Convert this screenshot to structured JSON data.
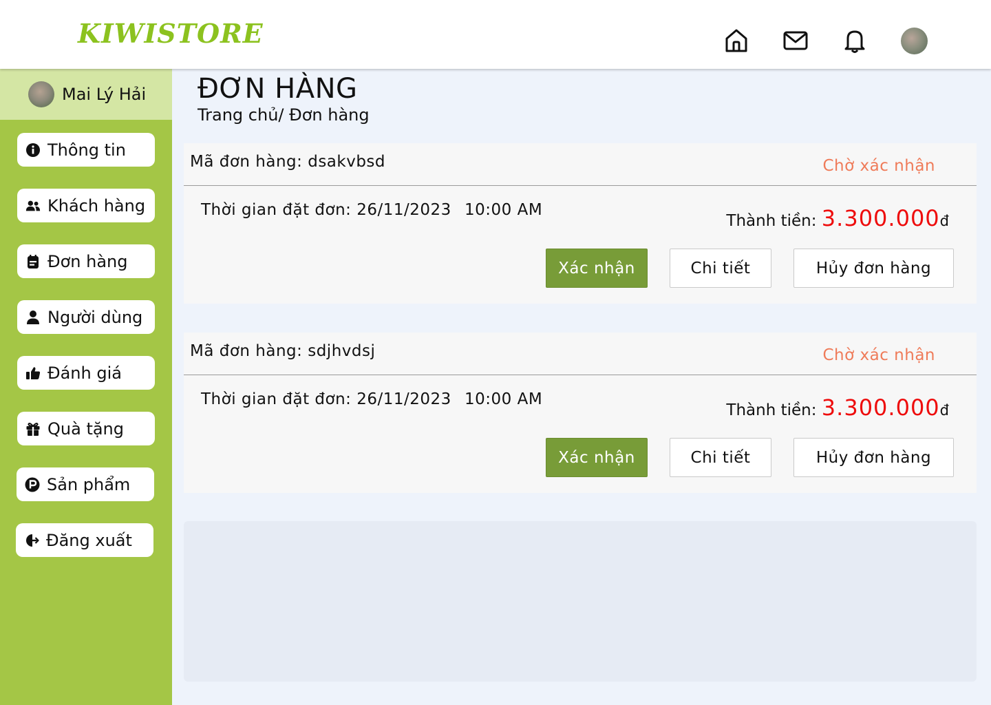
{
  "header": {
    "logo": "KIWISTORE",
    "icons": [
      "home-icon",
      "mail-icon",
      "bell-icon",
      "avatar"
    ]
  },
  "sidebar": {
    "user_name": "Mai Lý Hải",
    "items": [
      {
        "label": "Thông tin",
        "icon": "info-icon"
      },
      {
        "label": "Khách hàng",
        "icon": "users-icon"
      },
      {
        "label": "Đơn hàng",
        "icon": "orders-icon"
      },
      {
        "label": "Người dùng",
        "icon": "user-icon"
      },
      {
        "label": "Đánh giá",
        "icon": "thumbs-up-icon"
      },
      {
        "label": "Quà tặng",
        "icon": "gift-icon"
      },
      {
        "label": "Sản phẩm",
        "icon": "product-icon"
      },
      {
        "label": "Đăng xuất",
        "icon": "logout-icon"
      }
    ]
  },
  "main": {
    "title": "ĐƠN HÀNG",
    "breadcrumb": "Trang chủ/ Đơn hàng",
    "orders": [
      {
        "id_label": "Mã đơn hàng: dsakvbsd",
        "status": "Chờ xác nhận",
        "time_label": "Thời gian đặt đơn: 26/11/2023",
        "clock": "10:00 AM",
        "total_label": "Thành tiền: ",
        "total_amount": "3.300.000",
        "currency": "đ",
        "confirm_label": "Xác nhận",
        "detail_label": "Chi tiết",
        "cancel_label": "Hủy đơn hàng"
      },
      {
        "id_label": "Mã đơn hàng: sdjhvdsj",
        "status": "Chờ xác nhận",
        "time_label": "Thời gian đặt đơn: 26/11/2023",
        "clock": "10:00 AM",
        "total_label": "Thành tiền: ",
        "total_amount": "3.300.000",
        "currency": "đ",
        "confirm_label": "Xác nhận",
        "detail_label": "Chi tiết",
        "cancel_label": "Hủy đơn hàng"
      }
    ]
  },
  "colors": {
    "brand": "#8cc21f",
    "sidebar": "#a4c646",
    "confirm_button": "#789c38",
    "status": "#ef7b59",
    "price": "#ee0c0c"
  }
}
